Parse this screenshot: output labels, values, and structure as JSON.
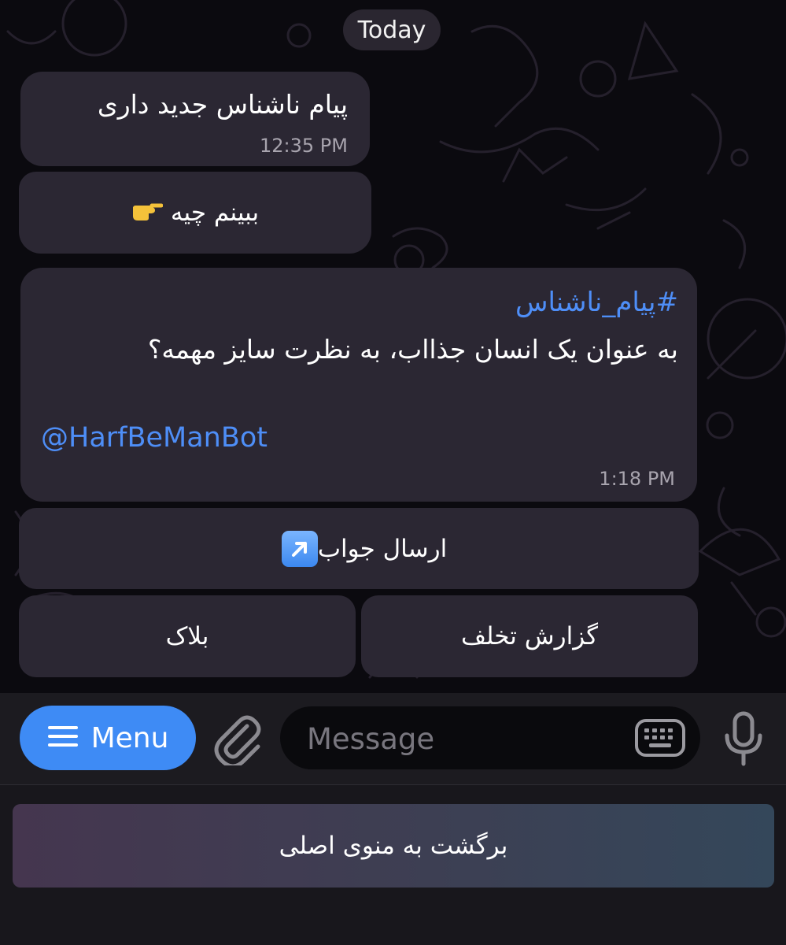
{
  "chat": {
    "date_label": "Today",
    "incoming1": {
      "text": "پیام ناشناس جدید داری",
      "time": "12:35 PM"
    },
    "btn_see": {
      "label": "ببینم چیه",
      "icon": "backhand-index-pointing-right-icon"
    },
    "incoming2": {
      "hashtag": "#پیام_ناشناس",
      "text": "به عنوان یک انسان جذااب، به نظرت سایز مهمه؟",
      "mention": "@HarfBeManBot",
      "time": "1:18 PM"
    },
    "inline_buttons": {
      "reply": {
        "label": "ارسال جواب",
        "icon": "up-right-arrow-icon"
      },
      "block": "بلاک",
      "report": "گزارش تخلف"
    }
  },
  "composer": {
    "menu_label": "Menu",
    "message_placeholder": "Message"
  },
  "reply_keyboard": {
    "back_label": "برگشت به منوی اصلی"
  },
  "colors": {
    "accent": "#3e8bf5",
    "link": "#4e8ef7",
    "bubble": "#2b2733",
    "background": "#0b0a0f"
  }
}
